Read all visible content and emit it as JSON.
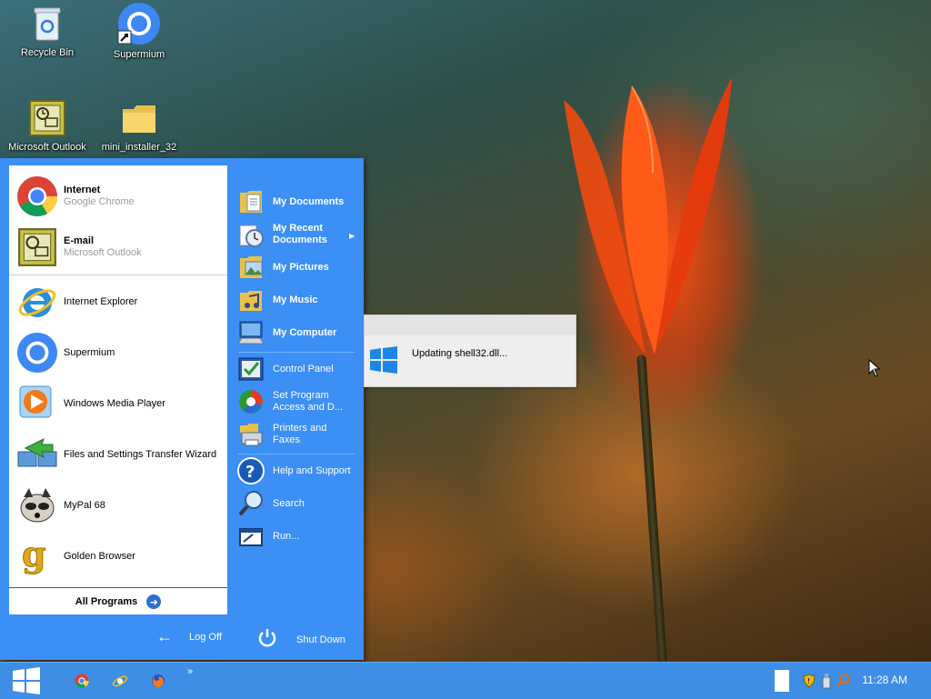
{
  "desktop": {
    "icons": [
      {
        "label": "Recycle Bin",
        "icon": "recycle-bin-icon"
      },
      {
        "label": "Supermium",
        "icon": "supermium-icon"
      },
      {
        "label": "Microsoft Outlook",
        "icon": "outlook-icon"
      },
      {
        "label": "mini_installer_32",
        "icon": "folder-icon"
      }
    ]
  },
  "start_menu": {
    "pinned": [
      {
        "title": "Internet",
        "subtitle": "Google Chrome",
        "icon": "chrome-icon"
      },
      {
        "title": "E-mail",
        "subtitle": "Microsoft Outlook",
        "icon": "outlook-icon"
      }
    ],
    "programs": [
      {
        "label": "Internet Explorer",
        "icon": "ie-icon"
      },
      {
        "label": "Supermium",
        "icon": "supermium-icon"
      },
      {
        "label": "Windows Media Player",
        "icon": "media-player-icon"
      },
      {
        "label": "Files and Settings Transfer Wizard",
        "icon": "transfer-wizard-icon"
      },
      {
        "label": "MyPal 68",
        "icon": "mypal-icon"
      },
      {
        "label": "Golden Browser",
        "icon": "golden-browser-icon"
      }
    ],
    "all_programs": "All Programs",
    "right": [
      {
        "label": "My Documents",
        "icon": "documents-folder-icon"
      },
      {
        "label": "My Recent Documents",
        "icon": "recent-documents-icon"
      },
      {
        "label": "My Pictures",
        "icon": "pictures-folder-icon"
      },
      {
        "label": "My Music",
        "icon": "music-folder-icon"
      },
      {
        "label": "My Computer",
        "icon": "computer-icon"
      },
      {
        "label": "Control Panel",
        "icon": "control-panel-icon"
      },
      {
        "label": "Set Program Access and D...",
        "icon": "program-access-icon"
      },
      {
        "label": "Printers and Faxes",
        "icon": "printer-icon"
      },
      {
        "label": "Help and Support",
        "icon": "help-icon"
      },
      {
        "label": "Search",
        "icon": "search-icon"
      },
      {
        "label": "Run...",
        "icon": "run-icon"
      }
    ],
    "log_off": "Log Off",
    "shut_down": "Shut Down"
  },
  "popup": {
    "message": "Updating shell32.dll..."
  },
  "taskbar": {
    "clock": "11:28 AM",
    "overflow": "»"
  },
  "colors": {
    "start_blue": "#3b8ff5",
    "taskbar_blue": "#3e8ee6"
  }
}
